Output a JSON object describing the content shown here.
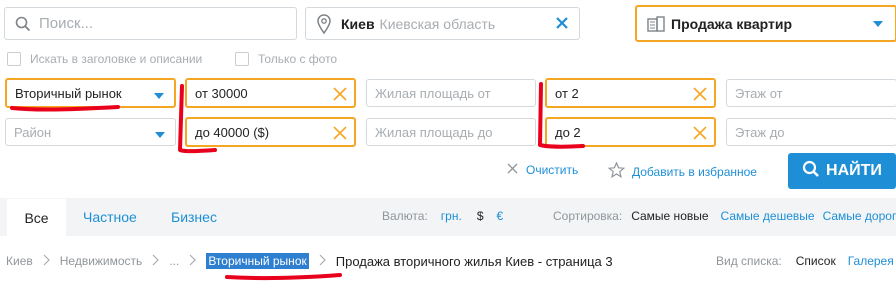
{
  "search": {
    "placeholder": "Поиск..."
  },
  "location": {
    "city": "Киев",
    "region": "Киевская область"
  },
  "category": {
    "label": "Продажа квартир"
  },
  "checkboxes": [
    {
      "label": "Искать в заголовке и описании",
      "checked": false
    },
    {
      "label": "Только с фото",
      "checked": false
    }
  ],
  "filters": {
    "market": "Вторичный рынок",
    "district_placeholder": "Район",
    "price_from": "от 30000",
    "price_to": "до 40000 ($)",
    "area_from_placeholder": "Жилая площадь от",
    "area_to_placeholder": "Жилая площадь до",
    "rooms_from": "от 2",
    "rooms_to": "до 2",
    "floor_from_placeholder": "Этаж от",
    "floor_to_placeholder": "Этаж до"
  },
  "actions": {
    "clear": "Очистить",
    "favorite": "Добавить в избранное",
    "find": "НАЙТИ"
  },
  "tabs": [
    {
      "label": "Все",
      "active": true
    },
    {
      "label": "Частное",
      "active": false
    },
    {
      "label": "Бизнес",
      "active": false
    }
  ],
  "currency": {
    "label": "Валюта:",
    "options": [
      "грн.",
      "$",
      "€"
    ],
    "selected": "$"
  },
  "sort": {
    "label": "Сортировка:",
    "options": [
      "Самые новые",
      "Самые дешевые",
      "Самые дорогие"
    ],
    "selected": "Самые новые"
  },
  "breadcrumbs": [
    "Киев",
    "Недвижимость",
    "...",
    "Вторичный рынок",
    "Продажа вторичного жилья Киев - страница 3"
  ],
  "view": {
    "label": "Вид списка:",
    "options": [
      "Список",
      "Галерея"
    ],
    "selected": "Список"
  },
  "colors": {
    "accent": "#1e8fd6",
    "highlight": "#f5a623",
    "annotation": "#e8001c"
  }
}
